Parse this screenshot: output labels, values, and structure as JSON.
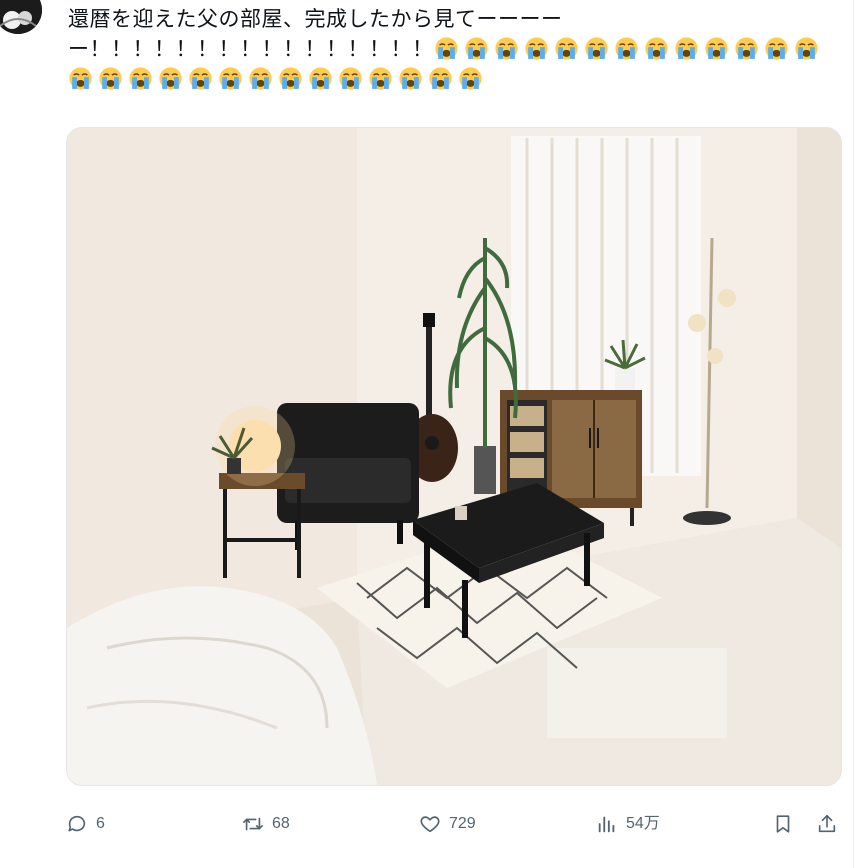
{
  "tweet": {
    "text_line1": "還暦を迎えた父の部屋、完成したから見てーーーー",
    "text_line2": "ー！！！！！！！！！！！！！！！！",
    "emoji_icon": "loudly-crying-face-icon",
    "emoji_count_line2": 13,
    "emoji_count_line3": 14
  },
  "media": {
    "alt": "",
    "icon": "room-photo"
  },
  "actions": {
    "reply": {
      "icon": "reply-icon",
      "count": "6"
    },
    "retweet": {
      "icon": "retweet-icon",
      "count": "68"
    },
    "like": {
      "icon": "heart-icon",
      "count": "729"
    },
    "views": {
      "icon": "views-chart-icon",
      "count": "54万"
    },
    "bookmark": {
      "icon": "bookmark-icon"
    },
    "share": {
      "icon": "share-icon"
    }
  },
  "colors": {
    "text": "#0f1419",
    "action_gray": "#536471",
    "emoji_yellow": "#ffcc4d",
    "tear_blue": "#5dadec"
  }
}
